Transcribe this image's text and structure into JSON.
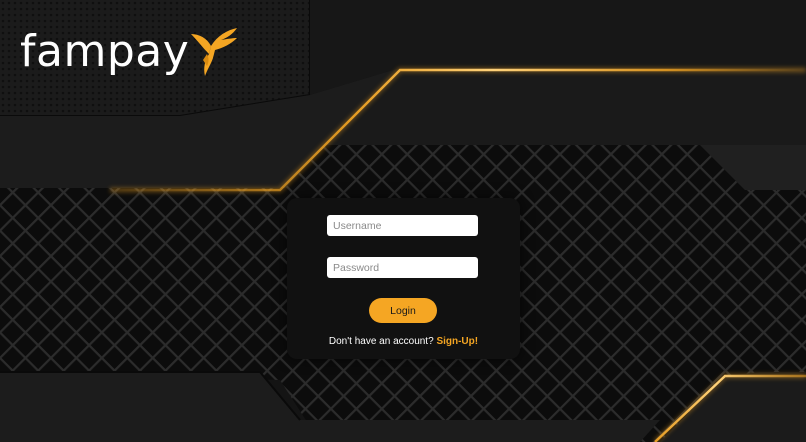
{
  "brand": {
    "name": "fampay",
    "logo_icon": "bird-logo-icon",
    "accent_color": "#f5a623"
  },
  "login_form": {
    "username_placeholder": "Username",
    "password_placeholder": "Password",
    "login_label": "Login",
    "signup_prompt": "Don't have an account? ",
    "signup_link_label": "Sign-Up!"
  },
  "theme": {
    "background": "#141414",
    "card_background": "#111111",
    "gold_line": "#f5a623"
  }
}
